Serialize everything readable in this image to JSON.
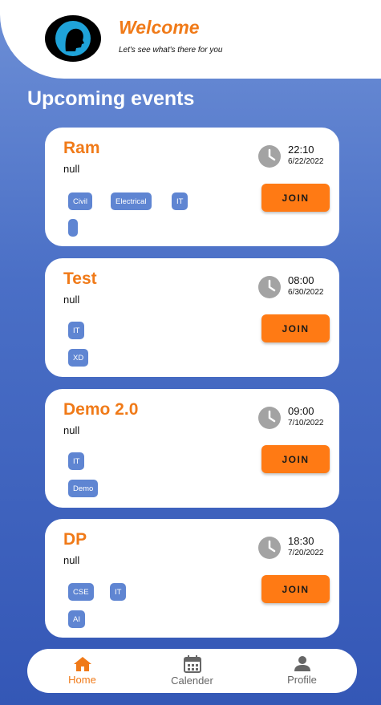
{
  "header": {
    "title": "Welcome",
    "subtitle": "Let's see what's there for you"
  },
  "section_title": "Upcoming events",
  "join_label": "JOIN",
  "events": [
    {
      "title": "Ram",
      "description": "null",
      "time": "22:10",
      "date": "6/22/2022",
      "tags": [
        "Civil",
        "Electrical",
        "IT",
        ""
      ]
    },
    {
      "title": "Test",
      "description": "null",
      "time": "08:00",
      "date": "6/30/2022",
      "tags": [
        "IT",
        "XD"
      ]
    },
    {
      "title": "Demo 2.0",
      "description": "null",
      "time": "09:00",
      "date": "7/10/2022",
      "tags": [
        "IT",
        "Demo"
      ]
    },
    {
      "title": "DP",
      "description": "null",
      "time": "18:30",
      "date": "7/20/2022",
      "tags": [
        "CSE",
        "IT",
        "AI"
      ]
    }
  ],
  "nav": {
    "home": "Home",
    "calendar": "Calender",
    "profile": "Profile"
  },
  "colors": {
    "accent": "#f07a18",
    "join_button": "#ff7a14",
    "tag": "#5f85d2"
  }
}
